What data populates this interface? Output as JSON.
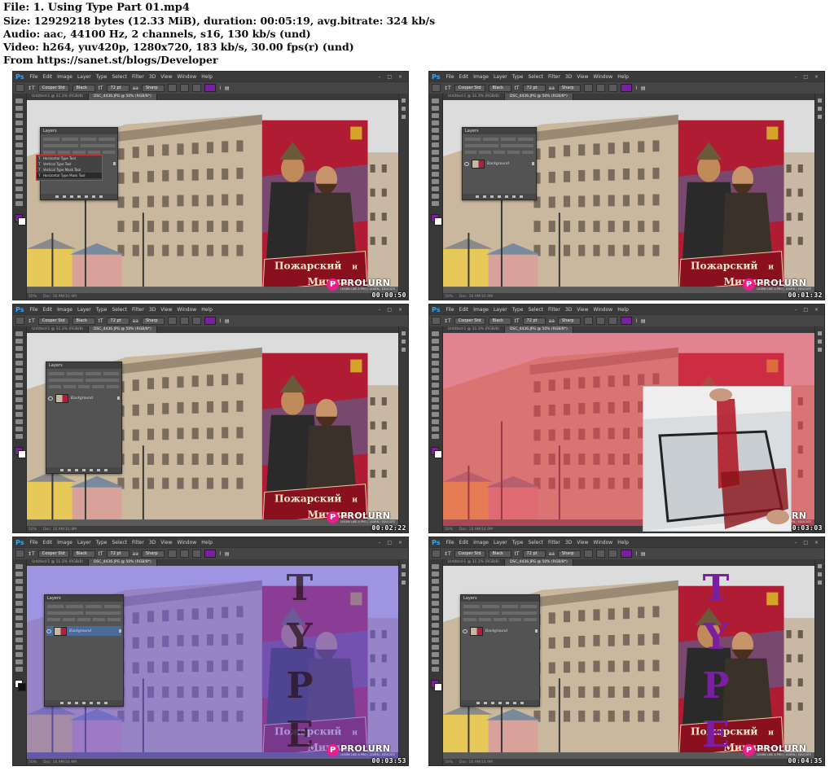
{
  "header": {
    "file_line": "File: 1. Using Type Part 01.mp4",
    "size_line": "Size: 12929218 bytes (12.33 MiB), duration: 00:05:19, avg.bitrate: 324 kb/s",
    "audio_line": "Audio: aac, 44100 Hz, 2 channels, s16, 130 kb/s (und)",
    "video_line": "Video: h264, yuv420p, 1280x720, 183 kb/s, 30.00 fps(r) (und)",
    "source_line": "From https://sanet.st/blogs/Developer"
  },
  "app": {
    "logo": "Ps",
    "menu": [
      "File",
      "Edit",
      "Image",
      "Layer",
      "Type",
      "Select",
      "Filter",
      "3D",
      "View",
      "Window",
      "Help"
    ],
    "window_controls": "– □ ×",
    "font_family": "Cooper Std",
    "font_style": "Black",
    "font_size": "72 pt",
    "antialias": "Sharp",
    "text_color": "#7b1fa2",
    "doc_tab_1": "Untitled-1 @ 31.3% (RGB/8)",
    "doc_tab_2": "DSC_4436.JPG @ 50% (RGB/8*)",
    "status_zoom": "50%",
    "status_doc": "Doc: 16.9M/16.9M"
  },
  "layers_panel": {
    "title": "Layers",
    "layer_name": "Background"
  },
  "type_tools_flyout": [
    "Horizontal Type Tool",
    "Vertical Type Tool",
    "Vertical Type Mask Tool",
    "Horizontal Type Mask Tool"
  ],
  "poster_text": {
    "line1": "Пожарский",
    "line2": "и",
    "line3": "Минин",
    "type_word": "TYPE"
  },
  "watermark": {
    "badge": "P",
    "name": "PROLURN",
    "tagline": "LEARN LIKE A PRO | LEARN | EDUCATE"
  },
  "frames": [
    {
      "timestamp": "00:00:50",
      "variant": "flyout"
    },
    {
      "timestamp": "00:01:32",
      "variant": "layers"
    },
    {
      "timestamp": "00:02:22",
      "variant": "layers-tall"
    },
    {
      "timestamp": "00:03:03",
      "variant": "red-overlay"
    },
    {
      "timestamp": "00:03:53",
      "variant": "blue-mask"
    },
    {
      "timestamp": "00:04:35",
      "variant": "type-result"
    }
  ],
  "colors": {
    "ps_blue": "#31a8ff",
    "poster_red": "#b01c34",
    "type_purple": "#7b1fa2",
    "prolurn_pink": "#e91e8c",
    "quick_mask_red": "rgba(230,60,80,0.55)",
    "quick_mask_blue": "rgba(110,90,230,0.55)"
  }
}
